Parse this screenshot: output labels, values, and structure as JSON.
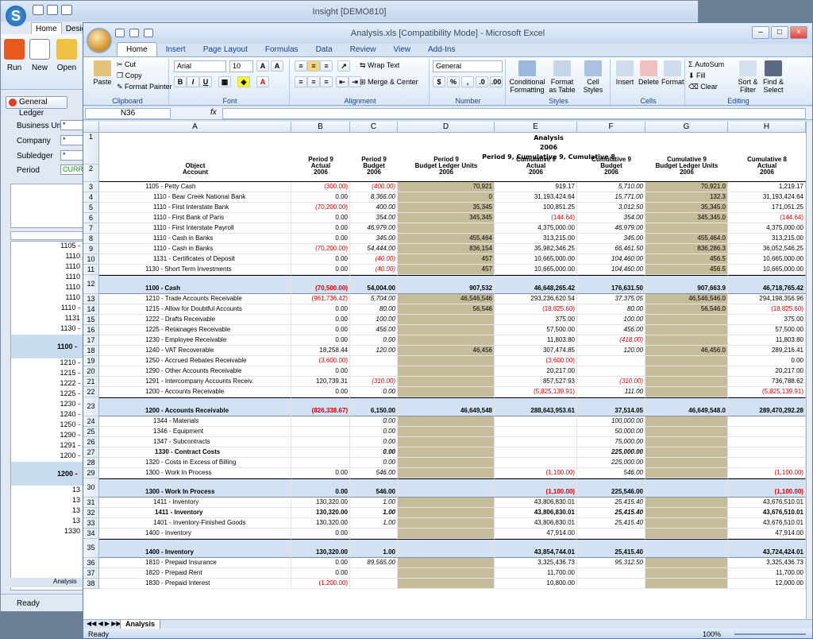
{
  "insight": {
    "title": "Insight [DEMO810]",
    "tabs": [
      "Home",
      "Design"
    ],
    "buttons": [
      "Run",
      "New",
      "Open"
    ],
    "panel_button": "General Ledger",
    "fields": [
      {
        "label": "Business Unit",
        "value": "*"
      },
      {
        "label": "Company",
        "value": "*"
      },
      {
        "label": "Subledger",
        "value": "*"
      },
      {
        "label": "Period",
        "value": "CURRE"
      }
    ],
    "side_rows": [
      "1105 -",
      "1110",
      "1110",
      "1110",
      "1110",
      "1110",
      "1110 -",
      "1131",
      "1130 -",
      "1100 -",
      "1210 -",
      "1215 -",
      "1222 -",
      "1225 -",
      "1230 -",
      "1240 -",
      "1250 -",
      "1290 -",
      "1291 -",
      "1200 -",
      "1200 -",
      "13",
      "13",
      "13",
      "13",
      "1330"
    ],
    "sheet_tab": "Analysis",
    "status": "Ready"
  },
  "excel": {
    "title": "Analysis.xls [Compatibility Mode] - Microsoft Excel",
    "tabs": [
      "Home",
      "Insert",
      "Page Layout",
      "Formulas",
      "Data",
      "Review",
      "View",
      "Add-Ins"
    ],
    "ribbon": {
      "clipboard": {
        "paste": "Paste",
        "cut": "Cut",
        "copy": "Copy",
        "format_painter": "Format Painter",
        "label": "Clipboard"
      },
      "font": {
        "name": "Arial",
        "size": "10",
        "label": "Font"
      },
      "alignment": {
        "wrap": "Wrap Text",
        "merge": "Merge & Center",
        "label": "Alignment"
      },
      "number": {
        "format": "General",
        "label": "Number"
      },
      "styles": {
        "cond": "Conditional Formatting",
        "table": "Format as Table",
        "cell": "Cell Styles",
        "label": "Styles"
      },
      "cells": {
        "insert": "Insert",
        "delete": "Delete",
        "format": "Format",
        "label": "Cells"
      },
      "editing": {
        "autosum": "AutoSum",
        "fill": "Fill",
        "clear": "Clear",
        "sort": "Sort & Filter",
        "find": "Find & Select",
        "label": "Editing"
      }
    },
    "name_box": "N36",
    "fx": "fx",
    "sheet_tab": "Analysis",
    "status": "Ready",
    "zoom": "100%",
    "columns": [
      "A",
      "B",
      "C",
      "D",
      "E",
      "F",
      "G",
      "H"
    ],
    "titles": [
      "Analysis",
      "2006",
      "Period 9, Cumulative 9, Cumulative 8"
    ],
    "headers": [
      "Object\nAccount",
      "Period 9\nActual\n2006",
      "Period 9\nBudget\n2006",
      "Period 9\nBudget Ledger Units\n2006",
      "Cumulative 9\nActual\n2006",
      "Cumulative 9\nBudget\n2006",
      "Cumulative 9\nBudget Ledger Units\n2006",
      "Cumulative 8\nActual\n2006"
    ],
    "rows": [
      {
        "n": "3",
        "a": "1105 - Petty Cash",
        "b": "(300.00)",
        "c": "(400.00)",
        "d": "70,921",
        "e": "919.17",
        "f": "5,710.00",
        "g": "70,921.0",
        "h": "1,219.17"
      },
      {
        "n": "4",
        "a": "1110 - Bear Creek National Bank",
        "b": "0.00",
        "c": "8,366.00",
        "d": "0",
        "e": "31,193,424.64",
        "f": "15,771.00",
        "g": "132.3",
        "h": "31,193,424.64"
      },
      {
        "n": "5",
        "a": "1110 - First Interstate Bank",
        "b": "(70,200.00)",
        "c": "400.00",
        "d": "35,345",
        "e": "100,851.25",
        "f": "3,012.50",
        "g": "35,345.0",
        "h": "171,051.25"
      },
      {
        "n": "6",
        "a": "1110 - First Bank of Paris",
        "b": "0.00",
        "c": "354.00",
        "d": "345,345",
        "e": "(144.64)",
        "f": "354.00",
        "g": "345,345.0",
        "h": "(144.64)"
      },
      {
        "n": "7",
        "a": "1110 - First Interstate Payroll",
        "b": "0.00",
        "c": "46,979.00",
        "d": "",
        "e": "4,375,000.00",
        "f": "46,979.00",
        "g": "",
        "h": "4,375,000.00"
      },
      {
        "n": "8",
        "a": "1110 - Cash in Banks",
        "b": "0.00",
        "c": "345.00",
        "d": "455,464",
        "e": "313,215.00",
        "f": "345.00",
        "g": "455,464.0",
        "h": "313,215.00"
      },
      {
        "n": "9",
        "a": "1110 - Cash in Banks",
        "b": "(70,200.00)",
        "c": "54,444.00",
        "d": "836,154",
        "e": "35,982,346.25",
        "f": "66,461.50",
        "g": "836,286.3",
        "h": "36,052,546.25"
      },
      {
        "n": "10",
        "a": "1131 - Certificates of Deposit",
        "b": "0.00",
        "c": "(40.00)",
        "d": "457",
        "e": "10,665,000.00",
        "f": "104,460.00",
        "g": "456.5",
        "h": "10,665,000.00"
      },
      {
        "n": "11",
        "a": "1130 - Short Term Investments",
        "b": "0.00",
        "c": "(40.00)",
        "d": "457",
        "e": "10,665,000.00",
        "f": "104,460.00",
        "g": "456.5",
        "h": "10,665,000.00"
      },
      {
        "n": "12",
        "sub": true,
        "a": "1100 - Cash",
        "b": "(70,500.00)",
        "c": "54,004.00",
        "d": "907,532",
        "e": "46,648,265.42",
        "f": "176,631.50",
        "g": "907,663.9",
        "h": "46,718,765.42"
      },
      {
        "n": "13",
        "a": "1210 - Trade Accounts Receivable",
        "b": "(961,736.42)",
        "c": "5,704.00",
        "d": "46,546,546",
        "e": "293,236,620.54",
        "f": "37,375.05",
        "g": "46,546,546.0",
        "h": "294,198,356.96"
      },
      {
        "n": "14",
        "a": "1215 - Allow for Doubtful Accounts",
        "b": "0.00",
        "c": "80.00",
        "d": "56,546",
        "e": "(18,825.60)",
        "f": "80.00",
        "g": "56,546.0",
        "h": "(18,825.60)"
      },
      {
        "n": "15",
        "a": "1222 - Drafts Receivable",
        "b": "0.00",
        "c": "100.00",
        "d": "",
        "e": "375.00",
        "f": "100.00",
        "g": "",
        "h": "375.00"
      },
      {
        "n": "16",
        "a": "1225 - Retainages Receivable",
        "b": "0.00",
        "c": "456.00",
        "d": "",
        "e": "57,500.00",
        "f": "456.00",
        "g": "",
        "h": "57,500.00"
      },
      {
        "n": "17",
        "a": "1230 - Employee Receivable",
        "b": "0.00",
        "c": "0.00",
        "d": "",
        "e": "11,803.80",
        "f": "(418.00)",
        "g": "",
        "h": "11,803.80"
      },
      {
        "n": "18",
        "a": "1240 - VAT Recoverable",
        "b": "18,258.44",
        "c": "120.00",
        "d": "46,456",
        "e": "307,474.85",
        "f": "120.00",
        "g": "46,456.0",
        "h": "289,216.41"
      },
      {
        "n": "19",
        "a": "1250 - Accrued Rebates Receivable",
        "b": "(3,600.00)",
        "c": "",
        "d": "",
        "e": "(3,600.00)",
        "f": "",
        "g": "",
        "h": "0.00"
      },
      {
        "n": "20",
        "a": "1290 - Other Accounts Receivable",
        "b": "0.00",
        "c": "",
        "d": "",
        "e": "20,217.00",
        "f": "",
        "g": "",
        "h": "20,217.00"
      },
      {
        "n": "21",
        "a": "1291 - Intercompany Accounts Receiv.",
        "b": "120,739.31",
        "c": "(310.00)",
        "d": "",
        "e": "857,527.93",
        "f": "(310.00)",
        "g": "",
        "h": "736,788.62"
      },
      {
        "n": "22",
        "a": "1200 - Accounts Receivable",
        "b": "0.00",
        "c": "0.00",
        "d": "",
        "e": "(5,825,139.91)",
        "f": "111.00",
        "g": "",
        "h": "(5,825,139.91)"
      },
      {
        "n": "23",
        "sub": true,
        "a": "1200 - Accounts Receivable",
        "b": "(826,338.67)",
        "c": "6,150.00",
        "d": "46,649,548",
        "e": "288,643,953.61",
        "f": "37,514.05",
        "g": "46,649,548.0",
        "h": "289,470,292.28"
      },
      {
        "n": "24",
        "a": "1344 - Materials",
        "b": "",
        "c": "0.00",
        "d": "",
        "e": "",
        "f": "100,000.00",
        "g": "",
        "h": ""
      },
      {
        "n": "25",
        "a": "1346 - Equipment",
        "b": "",
        "c": "0.00",
        "d": "",
        "e": "",
        "f": "50,000.00",
        "g": "",
        "h": ""
      },
      {
        "n": "26",
        "a": "1347 - Subcontracts",
        "b": "",
        "c": "0.00",
        "d": "",
        "e": "",
        "f": "75,000.00",
        "g": "",
        "h": ""
      },
      {
        "n": "27",
        "bold": true,
        "a": "1330 - Contract Costs",
        "b": "",
        "c": "0.00",
        "d": "",
        "e": "",
        "f": "225,000.00",
        "g": "",
        "h": ""
      },
      {
        "n": "28",
        "a": "1320 - Costs in Excess of Billing",
        "b": "",
        "c": "0.00",
        "d": "",
        "e": "",
        "f": "225,000.00",
        "g": "",
        "h": ""
      },
      {
        "n": "29",
        "a": "1300 - Work In Process",
        "b": "0.00",
        "c": "546.00",
        "d": "",
        "e": "(1,100.00)",
        "f": "546.00",
        "g": "",
        "h": "(1,100.00)"
      },
      {
        "n": "30",
        "sub": true,
        "a": "1300 - Work In Process",
        "b": "0.00",
        "c": "546.00",
        "d": "",
        "e": "(1,100.00)",
        "f": "225,546.00",
        "g": "",
        "h": "(1,100.00)"
      },
      {
        "n": "31",
        "a": "1411 - Inventory",
        "b": "130,320.00",
        "c": "1.00",
        "d": "",
        "e": "43,806,830.01",
        "f": "25,415.40",
        "g": "",
        "h": "43,676,510.01"
      },
      {
        "n": "32",
        "bold": true,
        "a": "1411 - Inventory",
        "b": "130,320.00",
        "c": "1.00",
        "d": "",
        "e": "43,806,830.01",
        "f": "25,415.40",
        "g": "",
        "h": "43,676,510.01"
      },
      {
        "n": "33",
        "a": "1401 - Inventory-Finished Goods",
        "b": "130,320.00",
        "c": "1.00",
        "d": "",
        "e": "43,806,830.01",
        "f": "25,415.40",
        "g": "",
        "h": "43,676,510.01"
      },
      {
        "n": "34",
        "a": "1400 - Inventory",
        "b": "0.00",
        "c": "",
        "d": "",
        "e": "47,914.00",
        "f": "",
        "g": "",
        "h": "47,914.00"
      },
      {
        "n": "35",
        "sub": true,
        "a": "1400 - Inventory",
        "b": "130,320.00",
        "c": "1.00",
        "d": "",
        "e": "43,854,744.01",
        "f": "25,415.40",
        "g": "",
        "h": "43,724,424.01"
      },
      {
        "n": "36",
        "a": "1810 - Prepaid Insurance",
        "b": "0.00",
        "c": "89,565.00",
        "d": "",
        "e": "3,325,436.73",
        "f": "95,312.50",
        "g": "",
        "h": "3,325,436.73"
      },
      {
        "n": "37",
        "a": "1820 - Prepaid Rent",
        "b": "0.00",
        "c": "",
        "d": "",
        "e": "11,700.00",
        "f": "",
        "g": "",
        "h": "11,700.00"
      },
      {
        "n": "38",
        "a": "1830 - Prepaid Interest",
        "b": "(1,200.00)",
        "c": "",
        "d": "",
        "e": "10,800.00",
        "f": "",
        "g": "",
        "h": "12,000.00"
      }
    ]
  }
}
